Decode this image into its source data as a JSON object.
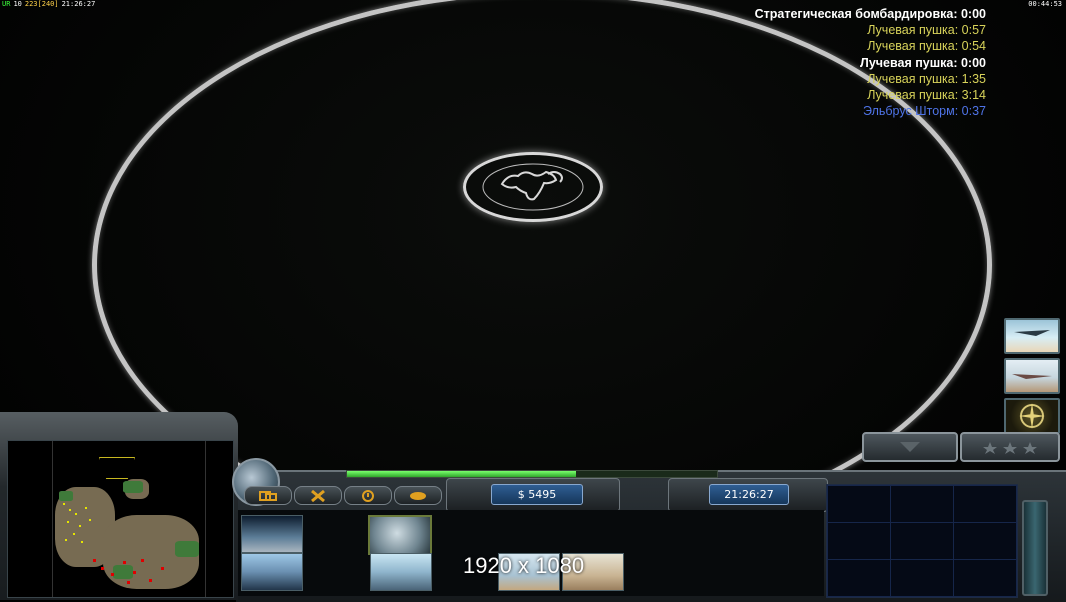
{
  "hud": {
    "top_left": [
      "UR",
      "10",
      "223[240]",
      "21:26:27"
    ],
    "top_right": "00:44:53"
  },
  "timers": [
    {
      "label": "Стратегическая бомбардировка: 0:00",
      "color": "white"
    },
    {
      "label": "Лучевая пушка: 0:57",
      "color": "yellow"
    },
    {
      "label": "Лучевая пушка: 0:54",
      "color": "yellow"
    },
    {
      "label": "Лучевая пушка: 0:00",
      "color": "white"
    },
    {
      "label": "Лучевая пушка: 1:35",
      "color": "yellow"
    },
    {
      "label": "Лучевая пушка: 3:14",
      "color": "yellow"
    },
    {
      "label": "Эльбрус Шторм: 0:37",
      "color": "blue"
    }
  ],
  "panel": {
    "money": "$ 5495",
    "clock": "21:26:27",
    "power_fraction": 0.62,
    "tabs": [
      "tab-build",
      "tab-repair",
      "tab-alert",
      "tab-chat"
    ],
    "overlay_text": "1920 x 1080"
  },
  "colors": {
    "timer_white": "#ffffff",
    "timer_yellow": "#d8d35a",
    "timer_blue": "#4f74e8",
    "power_green": "#4fdc46",
    "money_blue": "#2f5e93"
  },
  "icons": {
    "globe": "globe-icon",
    "side_buttons": [
      "bomber-icon",
      "jet-icon",
      "target-compass-icon"
    ]
  }
}
